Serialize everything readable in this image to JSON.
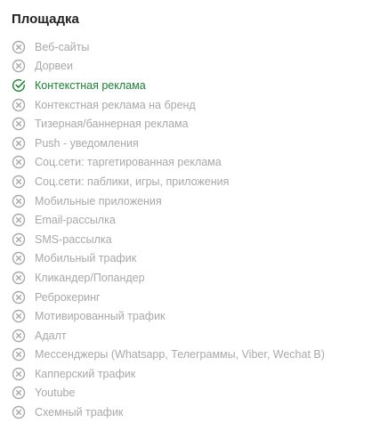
{
  "section": {
    "title": "Площадка"
  },
  "colors": {
    "inactive": "#a9a9a9",
    "active": "#1f7f35"
  },
  "items": [
    {
      "label": "Веб-сайты",
      "status": "inactive",
      "icon": "x-circle-icon"
    },
    {
      "label": "Дорвеи",
      "status": "inactive",
      "icon": "x-circle-icon"
    },
    {
      "label": "Контекстная реклама",
      "status": "active",
      "icon": "check-circle-icon"
    },
    {
      "label": "Контекстная реклама на бренд",
      "status": "inactive",
      "icon": "x-circle-icon"
    },
    {
      "label": "Тизерная/баннерная реклама",
      "status": "inactive",
      "icon": "x-circle-icon"
    },
    {
      "label": "Push - уведомления",
      "status": "inactive",
      "icon": "x-circle-icon"
    },
    {
      "label": "Соц.сети: таргетированная реклама",
      "status": "inactive",
      "icon": "x-circle-icon"
    },
    {
      "label": "Соц.сети: паблики, игры, приложения",
      "status": "inactive",
      "icon": "x-circle-icon"
    },
    {
      "label": "Мобильные приложения",
      "status": "inactive",
      "icon": "x-circle-icon"
    },
    {
      "label": "Email-рассылка",
      "status": "inactive",
      "icon": "x-circle-icon"
    },
    {
      "label": "SMS-рассылка",
      "status": "inactive",
      "icon": "x-circle-icon"
    },
    {
      "label": "Мобильный трафик",
      "status": "inactive",
      "icon": "x-circle-icon"
    },
    {
      "label": "Кликандер/Попандер",
      "status": "inactive",
      "icon": "x-circle-icon"
    },
    {
      "label": "Реброкеринг",
      "status": "inactive",
      "icon": "x-circle-icon"
    },
    {
      "label": "Мотивированный трафик",
      "status": "inactive",
      "icon": "x-circle-icon"
    },
    {
      "label": "Адалт",
      "status": "inactive",
      "icon": "x-circle-icon"
    },
    {
      "label": "Мессенджеры (Whatsapp, Телеграммы, Viber, Wechat В)",
      "status": "inactive",
      "icon": "x-circle-icon"
    },
    {
      "label": "Капперский трафик",
      "status": "inactive",
      "icon": "x-circle-icon"
    },
    {
      "label": "Youtube",
      "status": "inactive",
      "icon": "x-circle-icon"
    },
    {
      "label": "Схемный трафик",
      "status": "inactive",
      "icon": "x-circle-icon"
    }
  ]
}
